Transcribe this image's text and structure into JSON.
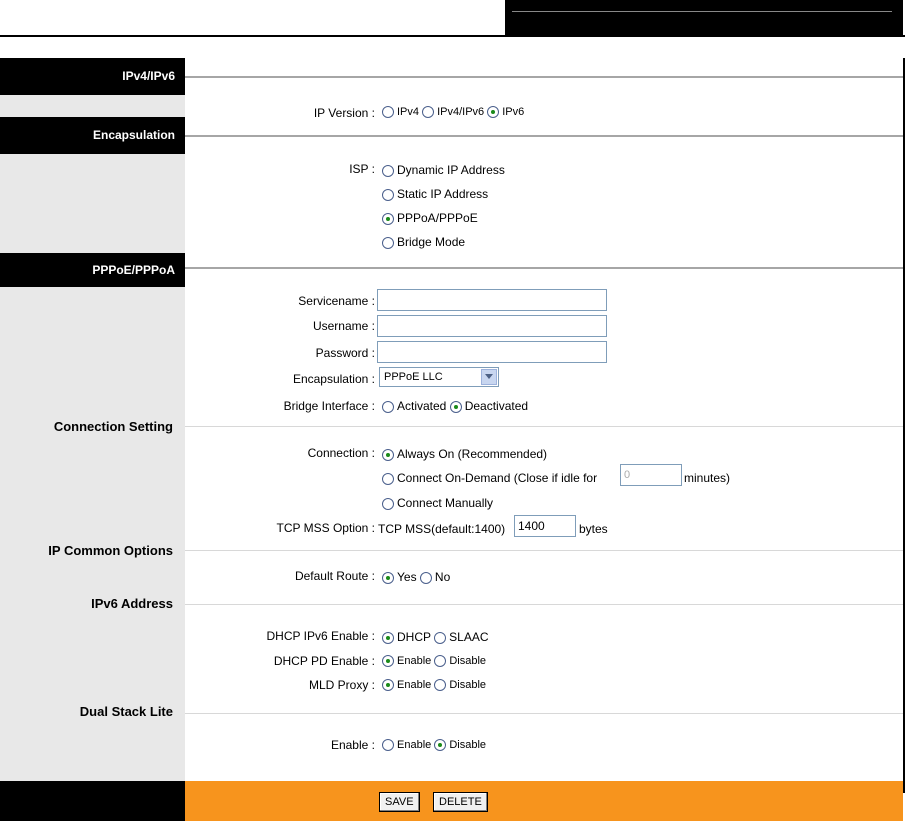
{
  "sections": {
    "ipv4ipv6": "IPv4/IPv6",
    "encapsulation": "Encapsulation",
    "pppoe": "PPPoE/PPPoA",
    "connection_setting": "Connection Setting",
    "ip_common": "IP Common Options",
    "ipv6_address": "IPv6 Address",
    "dslite": "Dual Stack Lite"
  },
  "ip_version": {
    "label": "IP Version :",
    "options": [
      "IPv4",
      "IPv4/IPv6",
      "IPv6"
    ],
    "selected": "IPv6"
  },
  "isp": {
    "label": "ISP :",
    "options": [
      "Dynamic IP Address",
      "Static IP Address",
      "PPPoA/PPPoE",
      "Bridge Mode"
    ],
    "selected": "PPPoA/PPPoE"
  },
  "pppoe": {
    "servicename_label": "Servicename :",
    "servicename_value": "",
    "username_label": "Username :",
    "username_value": "",
    "password_label": "Password :",
    "password_value": "",
    "encapsulation_label": "Encapsulation :",
    "encapsulation_value": "PPPoE LLC",
    "bridge_label": "Bridge Interface :",
    "bridge_options": [
      "Activated",
      "Deactivated"
    ],
    "bridge_selected": "Deactivated"
  },
  "connection": {
    "label": "Connection :",
    "always_on": "Always On (Recommended)",
    "on_demand_prefix": "Connect On-Demand (Close if idle for",
    "idle_minutes": "0",
    "on_demand_suffix": "minutes)",
    "manual": "Connect Manually",
    "selected": "Always On (Recommended)",
    "tcp_label": "TCP MSS Option :",
    "tcp_text": "TCP MSS(default:1400)",
    "tcp_value": "1400",
    "tcp_unit": "bytes"
  },
  "default_route": {
    "label": "Default Route :",
    "options": [
      "Yes",
      "No"
    ],
    "selected": "Yes"
  },
  "ipv6": {
    "dhcp_label": "DHCP IPv6 Enable :",
    "dhcp_options": [
      "DHCP",
      "SLAAC"
    ],
    "dhcp_selected": "DHCP",
    "pd_label": "DHCP PD Enable :",
    "pd_options": [
      "Enable",
      "Disable"
    ],
    "pd_selected": "Enable",
    "mld_label": "MLD Proxy :",
    "mld_options": [
      "Enable",
      "Disable"
    ],
    "mld_selected": "Enable"
  },
  "dslite": {
    "label": "Enable :",
    "options": [
      "Enable",
      "Disable"
    ],
    "selected": "Disable"
  },
  "buttons": {
    "save": "SAVE",
    "delete": "DELETE"
  },
  "colors": {
    "footer": "#f7941d",
    "header": "#000000"
  }
}
